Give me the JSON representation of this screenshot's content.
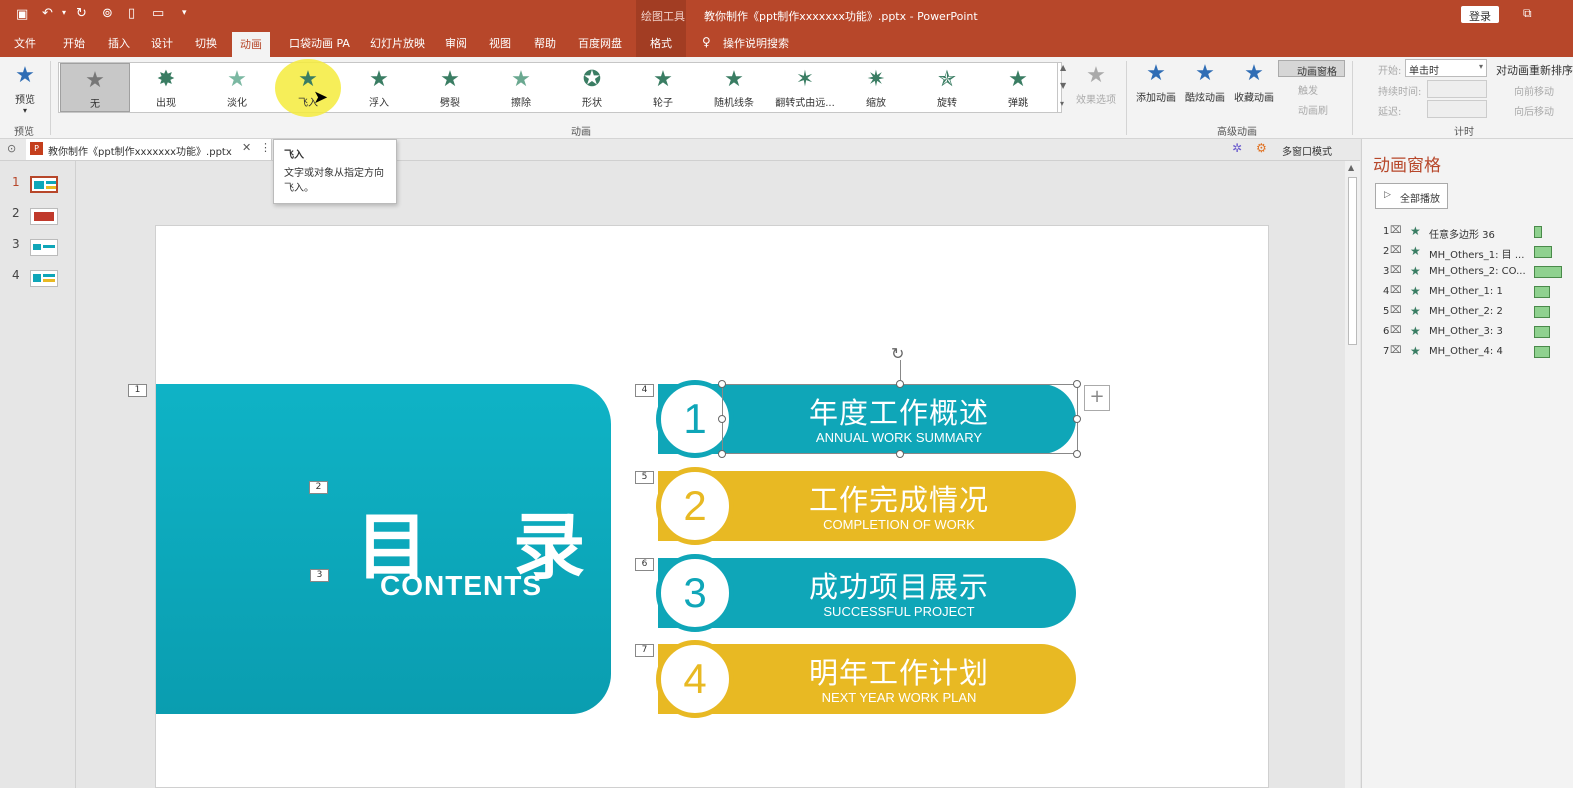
{
  "titlebar": {
    "context_tool": "绘图工具",
    "doc_title": "教你制作《ppt制作xxxxxxx功能》.pptx  -  PowerPoint",
    "login": "登录"
  },
  "tabs": [
    "文件",
    "开始",
    "插入",
    "设计",
    "切换",
    "动画",
    "口袋动画 PA",
    "幻灯片放映",
    "审阅",
    "视图",
    "帮助",
    "百度网盘",
    "格式"
  ],
  "tell_me": "操作说明搜索",
  "ribbon": {
    "preview_label": "预览",
    "preview_group": "预览",
    "effects": [
      "无",
      "出现",
      "淡化",
      "飞入",
      "浮入",
      "劈裂",
      "擦除",
      "形状",
      "轮子",
      "随机线条",
      "翻转式由远...",
      "缩放",
      "旋转",
      "弹跳"
    ],
    "effect_options": "效果选项",
    "animation_group": "动画",
    "add_animation": "添加动画",
    "cool_animation": "酷炫动画",
    "favorite_animation": "收藏动画",
    "anim_pane_btn": "动画窗格",
    "trigger": "触发",
    "anim_painter": "动画刷",
    "advanced_group": "高级动画",
    "start_label": "开始:",
    "start_value": "单击时",
    "duration_label": "持续时间:",
    "delay_label": "延迟:",
    "reorder_title": "对动画重新排序",
    "move_earlier": "向前移动",
    "move_later": "向后移动",
    "timing_group": "计时"
  },
  "tooltip": {
    "title": "飞入",
    "body": "文字或对象从指定方向飞入。"
  },
  "doctab": {
    "name": "教你制作《ppt制作xxxxxxx功能》.pptx",
    "multi_window": "多窗口模式"
  },
  "slides": [
    "1",
    "2",
    "3",
    "4"
  ],
  "slide": {
    "title_cn": "目 录",
    "title_en": "CONTENTS",
    "tags": [
      "1",
      "2",
      "3",
      "4",
      "5",
      "6",
      "7"
    ],
    "items": [
      {
        "num": "1",
        "title": "年度工作概述",
        "sub": "ANNUAL WORK SUMMARY"
      },
      {
        "num": "2",
        "title": "工作完成情况",
        "sub": "COMPLETION OF WORK"
      },
      {
        "num": "3",
        "title": "成功项目展示",
        "sub": "SUCCESSFUL PROJECT"
      },
      {
        "num": "4",
        "title": "明年工作计划",
        "sub": "NEXT YEAR WORK PLAN"
      }
    ]
  },
  "anim_pane": {
    "title": "动画窗格",
    "play_all": "全部播放",
    "items": [
      {
        "idx": "1",
        "name": "任意多边形 36"
      },
      {
        "idx": "2",
        "name": "MH_Others_1: 目 ..."
      },
      {
        "idx": "3",
        "name": "MH_Others_2: CO..."
      },
      {
        "idx": "4",
        "name": "MH_Other_1: 1"
      },
      {
        "idx": "5",
        "name": "MH_Other_2: 2"
      },
      {
        "idx": "6",
        "name": "MH_Other_3: 3"
      },
      {
        "idx": "7",
        "name": "MH_Other_4: 4"
      }
    ]
  },
  "colors": {
    "accent": "#b7472a",
    "teal": "#0fa6b8",
    "gold": "#e8b923",
    "star": "#3a7d63"
  }
}
